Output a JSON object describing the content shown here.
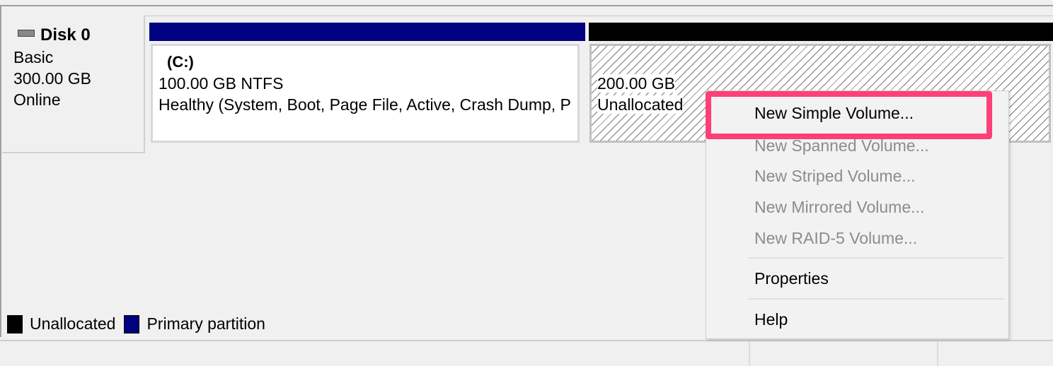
{
  "disk": {
    "name": "Disk 0",
    "type": "Basic",
    "size": "300.00 GB",
    "status": "Online"
  },
  "volumes": [
    {
      "label": "(C:)",
      "size_fs": "100.00 GB NTFS",
      "status": "Healthy (System, Boot, Page File, Active, Crash Dump, P",
      "bar_color": "#000080"
    },
    {
      "size": "200.00 GB",
      "status": "Unallocated",
      "bar_color": "#000000"
    }
  ],
  "context_menu": {
    "items": [
      {
        "label": "New Simple Volume...",
        "enabled": true
      },
      {
        "label": "New Spanned Volume...",
        "enabled": false
      },
      {
        "label": "New Striped Volume...",
        "enabled": false
      },
      {
        "label": "New Mirrored Volume...",
        "enabled": false
      },
      {
        "label": "New RAID-5 Volume...",
        "enabled": false
      },
      {
        "label": "Properties",
        "enabled": true
      },
      {
        "label": "Help",
        "enabled": true
      }
    ],
    "highlight_color": "#ff3f78"
  },
  "legend": [
    {
      "label": "Unallocated",
      "color": "#000000"
    },
    {
      "label": "Primary partition",
      "color": "#000080"
    }
  ]
}
